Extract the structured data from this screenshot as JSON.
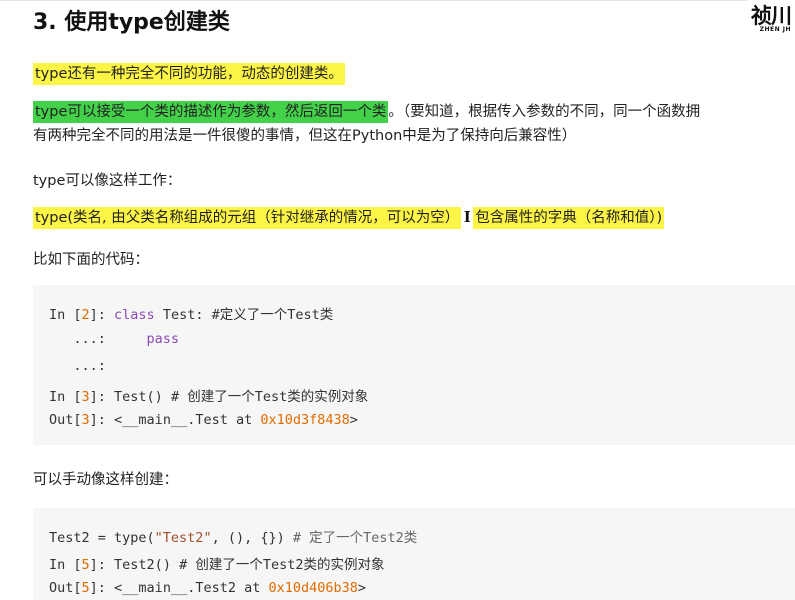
{
  "heading": "3. 使用type创建类",
  "logo": {
    "main": "祯川",
    "sub": "ZHEN JH"
  },
  "paragraphs": {
    "p1": "type还有一种完全不同的功能，动态的创建类。",
    "p2_highlight": "type可以接受一个类的描述作为参数，然后返回一个类",
    "p2_rest": "。（要知道，根据传入参数的不同，同一个函数拥",
    "p2_line2": "有两种完全不同的用法是一件很傻的事情，但这在Python中是为了保持向后兼容性）",
    "p3": "type可以像这样工作：",
    "p4_part1": "type(类名, 由父类名称组成的元组（针对继承的情况，可以为空）",
    "p4_part2": "包含属性的字典（名称和值）)",
    "p5": "比如下面的代码：",
    "p6": "可以手动像这样创建："
  },
  "code_block_1": {
    "line1": {
      "prompt_a": "In [",
      "num": "2",
      "prompt_b": "]: ",
      "kw": "class",
      "rest": " Test: #定义了一个Test类"
    },
    "line2": {
      "prompt": "   ...:     ",
      "kw": "pass"
    },
    "line3": {
      "prompt": "   ...:"
    },
    "line4": {
      "prompt_a": "In [",
      "num": "3",
      "prompt_b": "]: ",
      "rest": "Test() # 创建了一个Test类的实例对象"
    },
    "line5": {
      "prompt_a": "Out[",
      "num": "3",
      "prompt_b": "]: ",
      "rest": "<__main__.Test at ",
      "addr": "0x10d3f8438",
      "tail": ">"
    }
  },
  "code_block_2": {
    "line1": {
      "pre": "Test2 = type(",
      "str": "\"Test2\"",
      "post": ", (), {}) ",
      "cmt": "# 定了一个Test2类"
    },
    "line2": {
      "prompt_a": "In [",
      "num": "5",
      "prompt_b": "]: ",
      "rest": "Test2() # 创建了一个Test2类的实例对象"
    },
    "line3": {
      "prompt_a": "Out[",
      "num": "5",
      "prompt_b": "]: ",
      "rest": "<__main__.Test2 at ",
      "addr": "0x10d406b38",
      "tail": ">"
    }
  },
  "colors": {
    "highlight_yellow": "#fdf545",
    "highlight_green": "#43d14a",
    "code_background": "#f6f6f6",
    "number_orange": "#e06c00",
    "keyword_purple": "#8a4ab8"
  }
}
